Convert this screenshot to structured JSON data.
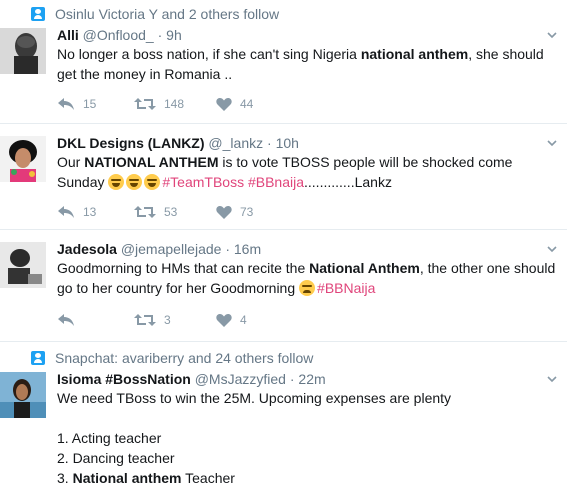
{
  "tweets": [
    {
      "context": "Osinlu Victoria Y and 2 others follow",
      "name": "Alli",
      "handle": "@Onflood_",
      "time": "9h",
      "text_parts": [
        "No longer a boss nation, if she can't sing Nigeria ",
        "national anthem",
        ", she should get the money in Romania .."
      ],
      "replies": "15",
      "retweets": "148",
      "likes": "44"
    },
    {
      "name": "DKL Designs (LANKZ)",
      "handle": "@_lankz",
      "time": "10h",
      "text_parts": [
        "Our ",
        "NATIONAL ANTHEM",
        " is to vote TBOSS people will be shocked come Sunday "
      ],
      "hashtags": "#TeamTBoss #BBnaija",
      "tail": ".............Lankz",
      "replies": "13",
      "retweets": "53",
      "likes": "73"
    },
    {
      "name": "Jadesola",
      "handle": "@jemapellejade",
      "time": "16m",
      "text_parts": [
        "Goodmorning to HMs that can recite the ",
        "National Anthem",
        ", the other one should go to her country for her Goodmorning "
      ],
      "hashtags": "#BBNaija",
      "replies": "",
      "retweets": "3",
      "likes": "4"
    },
    {
      "context": "Snapchat: avariberry and 24 others follow",
      "name": "Isioma #BossNation",
      "handle": "@MsJazzyfied",
      "time": "22m",
      "text_line1": "We need TBoss to win the 25M. Upcoming expenses are plenty",
      "list": [
        "1. Acting teacher",
        "2. Dancing teacher"
      ],
      "item3_num": "3. ",
      "item3_bold": "National anthem",
      "item3_rest": " Teacher"
    }
  ],
  "colors": {
    "hashtag": "#e0457b",
    "meta": "#657786",
    "icon": "#8899a6",
    "accent": "#1da1f2"
  },
  "icons": {
    "reply": "reply-icon",
    "retweet": "retweet-icon",
    "like": "heart-icon",
    "caret": "chevron-down-icon",
    "follow": "user-follow-icon"
  }
}
